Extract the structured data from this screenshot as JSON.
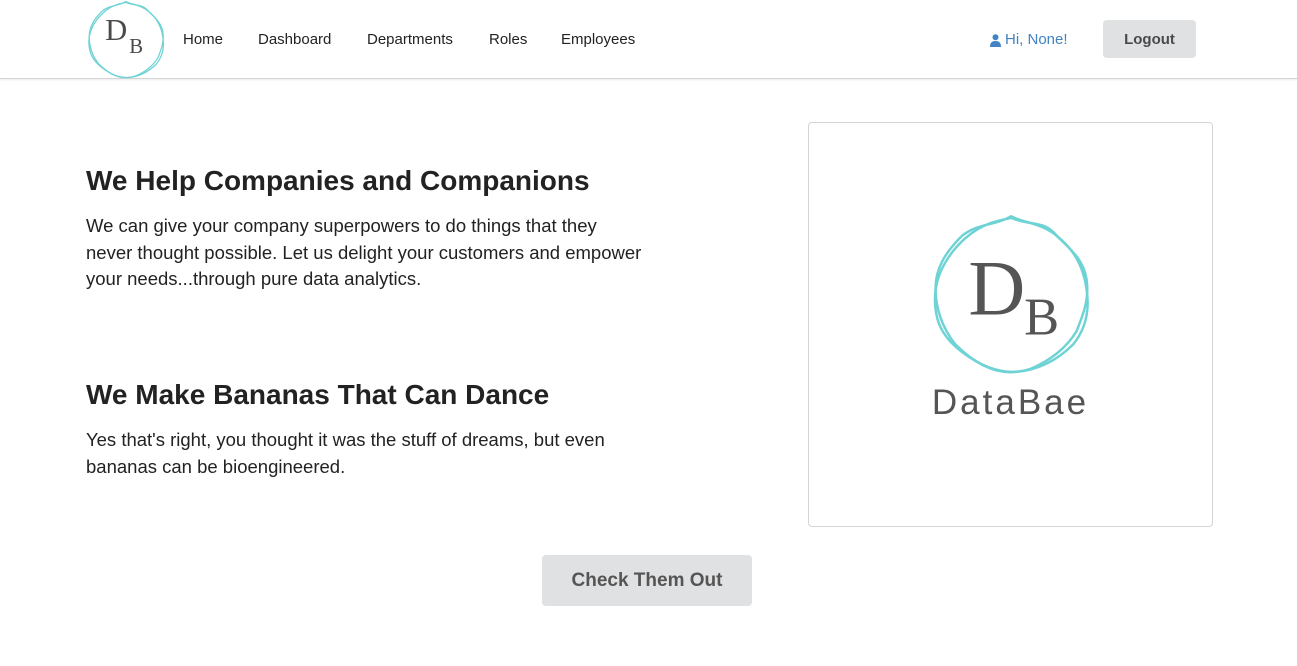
{
  "nav": {
    "logo_letters": {
      "first": "D",
      "second": "B"
    },
    "items": [
      {
        "label": "Home"
      },
      {
        "label": "Dashboard"
      },
      {
        "label": "Departments"
      },
      {
        "label": "Roles"
      },
      {
        "label": "Employees"
      }
    ],
    "greeting": "Hi, None!",
    "logout_label": "Logout"
  },
  "sections": [
    {
      "heading": "We Help Companies and Companions",
      "body": "We can give your company superpowers to do things that they never thought possible. Let us delight your customers and empower your needs...through pure data analytics."
    },
    {
      "heading": "We Make Bananas That Can Dance",
      "body": "Yes that's right, you thought it was the stuff of dreams, but even bananas can be bioengineered."
    }
  ],
  "card": {
    "logo_letters": {
      "first": "D",
      "second": "B"
    },
    "brand_name": "DataBae"
  },
  "cta_label": "Check Them Out",
  "colors": {
    "accent_teal": "#6fd3d5",
    "link_blue": "#4183c4",
    "button_gray": "#e0e1e2"
  }
}
